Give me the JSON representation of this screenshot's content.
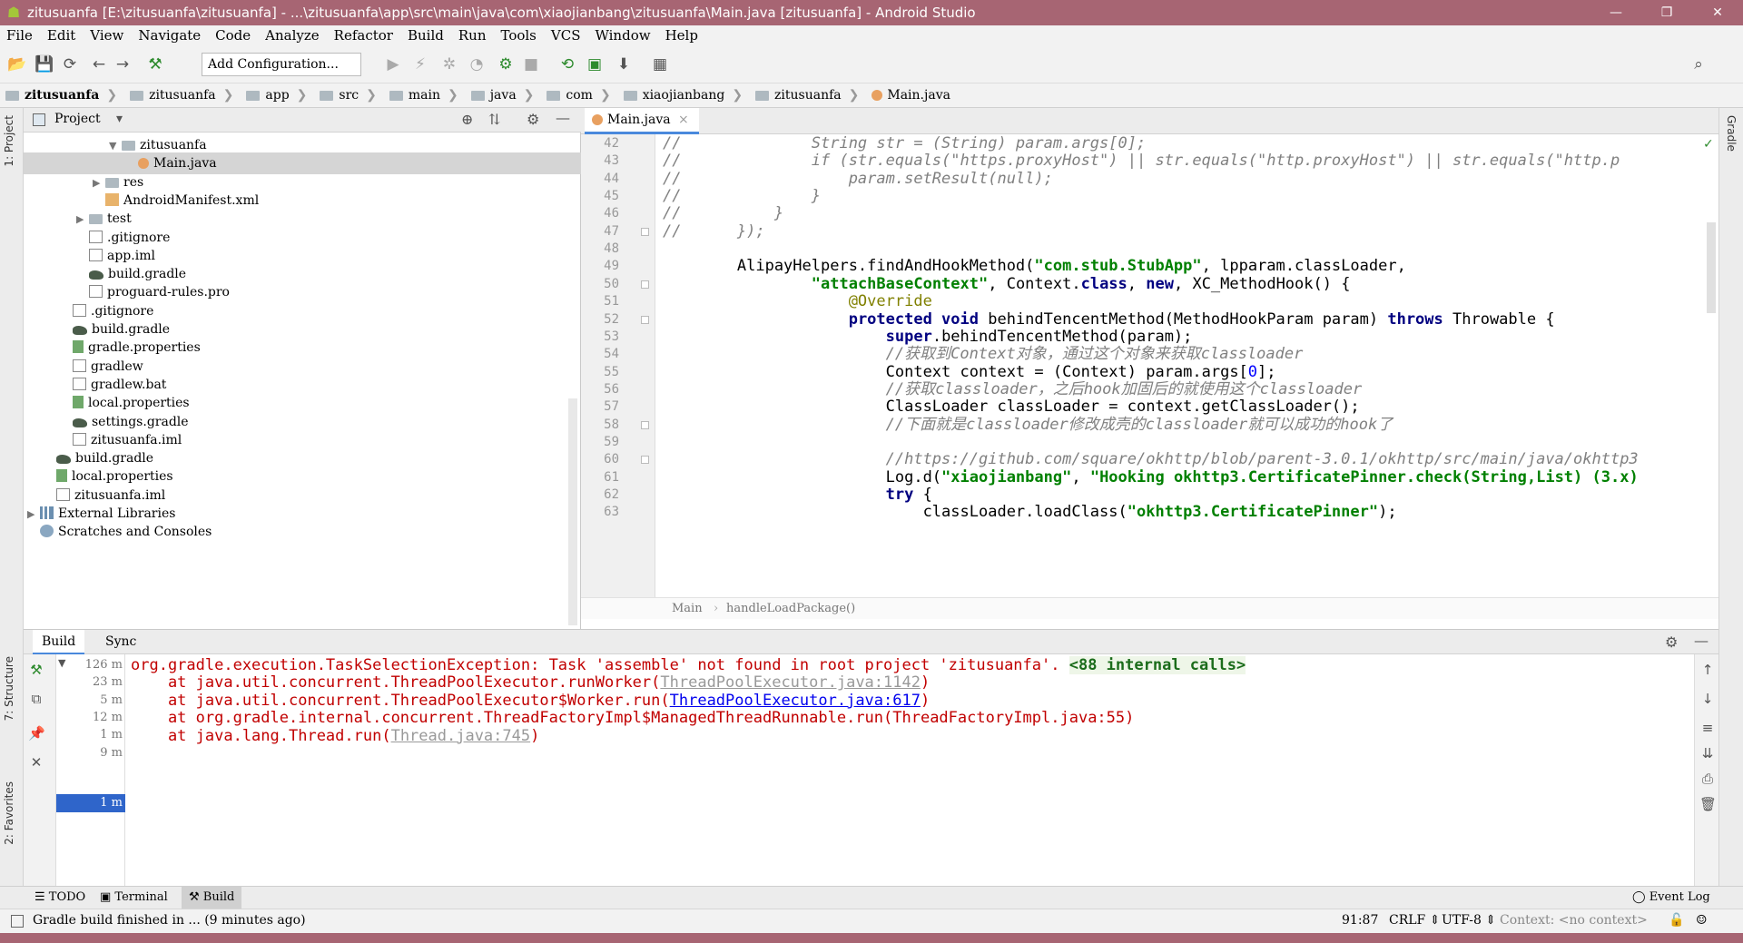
{
  "window": {
    "title": "zitusuanfa [E:\\zitusuanfa\\zitusuanfa] - ...\\zitusuanfa\\app\\src\\main\\java\\com\\xiaojianbang\\zitusuanfa\\Main.java [zitusuanfa] - Android Studio",
    "minimize": "—",
    "maximize": "❐",
    "close": "✕"
  },
  "menu": [
    "File",
    "Edit",
    "View",
    "Navigate",
    "Code",
    "Analyze",
    "Refactor",
    "Build",
    "Run",
    "Tools",
    "VCS",
    "Window",
    "Help"
  ],
  "toolbar": {
    "add_config": "Add Configuration..."
  },
  "breadcrumb": [
    "zitusuanfa",
    "zitusuanfa",
    "app",
    "src",
    "main",
    "java",
    "com",
    "xiaojianbang",
    "zitusuanfa",
    "Main.java"
  ],
  "project": {
    "title": "Project",
    "tree": [
      {
        "label": "zitusuanfa",
        "indent": 5,
        "icon": "folder",
        "arrow": "▼"
      },
      {
        "label": "Main.java",
        "indent": 6,
        "icon": "java",
        "arrow": "",
        "selected": true
      },
      {
        "label": "res",
        "indent": 4,
        "icon": "folder",
        "arrow": "▶"
      },
      {
        "label": "AndroidManifest.xml",
        "indent": 4,
        "icon": "xml",
        "arrow": ""
      },
      {
        "label": "test",
        "indent": 3,
        "icon": "folder",
        "arrow": "▶"
      },
      {
        "label": ".gitignore",
        "indent": 3,
        "icon": "file",
        "arrow": ""
      },
      {
        "label": "app.iml",
        "indent": 3,
        "icon": "file",
        "arrow": ""
      },
      {
        "label": "build.gradle",
        "indent": 3,
        "icon": "gradle",
        "arrow": ""
      },
      {
        "label": "proguard-rules.pro",
        "indent": 3,
        "icon": "file",
        "arrow": ""
      },
      {
        "label": ".gitignore",
        "indent": 2,
        "icon": "file",
        "arrow": ""
      },
      {
        "label": "build.gradle",
        "indent": 2,
        "icon": "gradle",
        "arrow": ""
      },
      {
        "label": "gradle.properties",
        "indent": 2,
        "icon": "props",
        "arrow": ""
      },
      {
        "label": "gradlew",
        "indent": 2,
        "icon": "file",
        "arrow": ""
      },
      {
        "label": "gradlew.bat",
        "indent": 2,
        "icon": "file",
        "arrow": ""
      },
      {
        "label": "local.properties",
        "indent": 2,
        "icon": "props",
        "arrow": ""
      },
      {
        "label": "settings.gradle",
        "indent": 2,
        "icon": "gradle",
        "arrow": ""
      },
      {
        "label": "zitusuanfa.iml",
        "indent": 2,
        "icon": "file",
        "arrow": ""
      },
      {
        "label": "build.gradle",
        "indent": 1,
        "icon": "gradle",
        "arrow": ""
      },
      {
        "label": "local.properties",
        "indent": 1,
        "icon": "props",
        "arrow": ""
      },
      {
        "label": "zitusuanfa.iml",
        "indent": 1,
        "icon": "file",
        "arrow": ""
      },
      {
        "label": "External Libraries",
        "indent": 0,
        "icon": "lib",
        "arrow": "▶"
      },
      {
        "label": "Scratches and Consoles",
        "indent": 0,
        "icon": "scratch",
        "arrow": ""
      }
    ]
  },
  "editor": {
    "tab": "Main.java",
    "tab_close": "×",
    "lines": [
      {
        "n": "42",
        "t": [
          [
            "cm",
            "//              String str = (String) param.args[0];"
          ]
        ]
      },
      {
        "n": "43",
        "t": [
          [
            "cm",
            "//              if (str.equals(\"https.proxyHost\") || str.equals(\"http.proxyHost\") || str.equals(\"http.p"
          ]
        ]
      },
      {
        "n": "44",
        "t": [
          [
            "cm",
            "//                  param.setResult(null);"
          ]
        ]
      },
      {
        "n": "45",
        "t": [
          [
            "cm",
            "//              }"
          ]
        ]
      },
      {
        "n": "46",
        "t": [
          [
            "cm",
            "//          }"
          ]
        ]
      },
      {
        "n": "47",
        "t": [
          [
            "cm",
            "//      });"
          ]
        ]
      },
      {
        "n": "48",
        "t": []
      },
      {
        "n": "49",
        "t": [
          [
            "",
            "        AlipayHelpers.findAndHookMethod("
          ],
          [
            "st",
            "\"com.stub.StubApp\""
          ],
          [
            "",
            ", lpparam.classLoader,"
          ]
        ]
      },
      {
        "n": "50",
        "t": [
          [
            "",
            "                "
          ],
          [
            "st",
            "\"attachBaseContext\""
          ],
          [
            "",
            ", Context."
          ],
          [
            "kw",
            "class"
          ],
          [
            "",
            ", "
          ],
          [
            "kw",
            "new"
          ],
          [
            "",
            ", XC_MethodHook() {"
          ]
        ]
      },
      {
        "n": "51",
        "t": [
          [
            "an",
            "                    @Override"
          ]
        ]
      },
      {
        "n": "52",
        "t": [
          [
            "",
            "                    "
          ],
          [
            "kw",
            "protected void"
          ],
          [
            "",
            " behindTencentMethod(MethodHookParam param) "
          ],
          [
            "kw",
            "throws"
          ],
          [
            "",
            " Throwable {"
          ]
        ]
      },
      {
        "n": "53",
        "t": [
          [
            "",
            "                        "
          ],
          [
            "kw",
            "super"
          ],
          [
            "",
            ".behindTencentMethod(param);"
          ]
        ]
      },
      {
        "n": "54",
        "t": [
          [
            "cm",
            "                        //获取到Context对象，通过这个对象来获取classloader"
          ]
        ]
      },
      {
        "n": "55",
        "t": [
          [
            "",
            "                        Context context = (Context) param.args["
          ],
          [
            "nm",
            "0"
          ],
          [
            "",
            "];"
          ]
        ]
      },
      {
        "n": "56",
        "t": [
          [
            "cm",
            "                        //获取classloader，之后hook加固后的就使用这个classloader"
          ]
        ]
      },
      {
        "n": "57",
        "t": [
          [
            "",
            "                        ClassLoader classLoader = context.getClassLoader();"
          ]
        ]
      },
      {
        "n": "58",
        "t": [
          [
            "cm",
            "                        //下面就是classloader修改成壳的classloader就可以成功的hook了"
          ]
        ]
      },
      {
        "n": "59",
        "t": []
      },
      {
        "n": "60",
        "t": [
          [
            "cm",
            "                        //https://github.com/square/okhttp/blob/parent-3.0.1/okhttp/src/main/java/okhttp3"
          ]
        ]
      },
      {
        "n": "61",
        "t": [
          [
            "",
            "                        Log.d("
          ],
          [
            "st",
            "\"xiaojianbang\""
          ],
          [
            "",
            ", "
          ],
          [
            "st",
            "\"Hooking okhttp3.CertificatePinner.check(String,List) (3.x)"
          ]
        ]
      },
      {
        "n": "62",
        "t": [
          [
            "",
            "                        "
          ],
          [
            "kw",
            "try"
          ],
          [
            "",
            " {"
          ]
        ]
      },
      {
        "n": "63",
        "t": [
          [
            "",
            "                            classLoader.loadClass("
          ],
          [
            "st",
            "\"okhttp3.CertificatePinner\""
          ],
          [
            "",
            ");"
          ]
        ]
      }
    ],
    "status": [
      "Main",
      "handleLoadPackage()"
    ]
  },
  "build": {
    "tabs": [
      "Build",
      "Sync"
    ],
    "tree_times": [
      "126 m",
      "23 m",
      "5 m",
      "12 m",
      "1 m",
      "9 m"
    ],
    "selected_time": "1 m",
    "console": [
      [
        [
          "",
          "org.gradle.execution.TaskSelectionException: Task 'assemble' not found in root project 'zitusuanfa'. "
        ],
        [
          "ic",
          "<88 internal calls>"
        ]
      ],
      [
        [
          "",
          "    at java.util.concurrent.ThreadPoolExecutor.runWorker("
        ],
        [
          "glnk",
          "ThreadPoolExecutor.java:1142"
        ],
        [
          "",
          ")"
        ]
      ],
      [
        [
          "",
          "    at java.util.concurrent.ThreadPoolExecutor$Worker.run("
        ],
        [
          "lnk",
          "ThreadPoolExecutor.java:617"
        ],
        [
          "",
          ")"
        ]
      ],
      [
        [
          "",
          "    at org.gradle.internal.concurrent.ThreadFactoryImpl$ManagedThreadRunnable.run(ThreadFactoryImpl.java:55)"
        ]
      ],
      [
        [
          "",
          "    at java.lang.Thread.run("
        ],
        [
          "glnk",
          "Thread.java:745"
        ],
        [
          "",
          ")"
        ]
      ]
    ]
  },
  "left_tabs": [
    "1: Project",
    "7: Structure",
    "2: Favorites"
  ],
  "right_tabs": [
    "Gradle"
  ],
  "bottom": {
    "todo": "TODO",
    "terminal": "Terminal",
    "build": "Build",
    "event_log": "Event Log"
  },
  "status": {
    "message": "Gradle build finished in ... (9 minutes ago)",
    "position": "91:87",
    "line_sep": "CRLF",
    "encoding": "UTF-8",
    "context": "Context: <no context>"
  },
  "colors": {
    "title": "#a76573",
    "accent": "#4a89dc",
    "error": "#c10000"
  }
}
